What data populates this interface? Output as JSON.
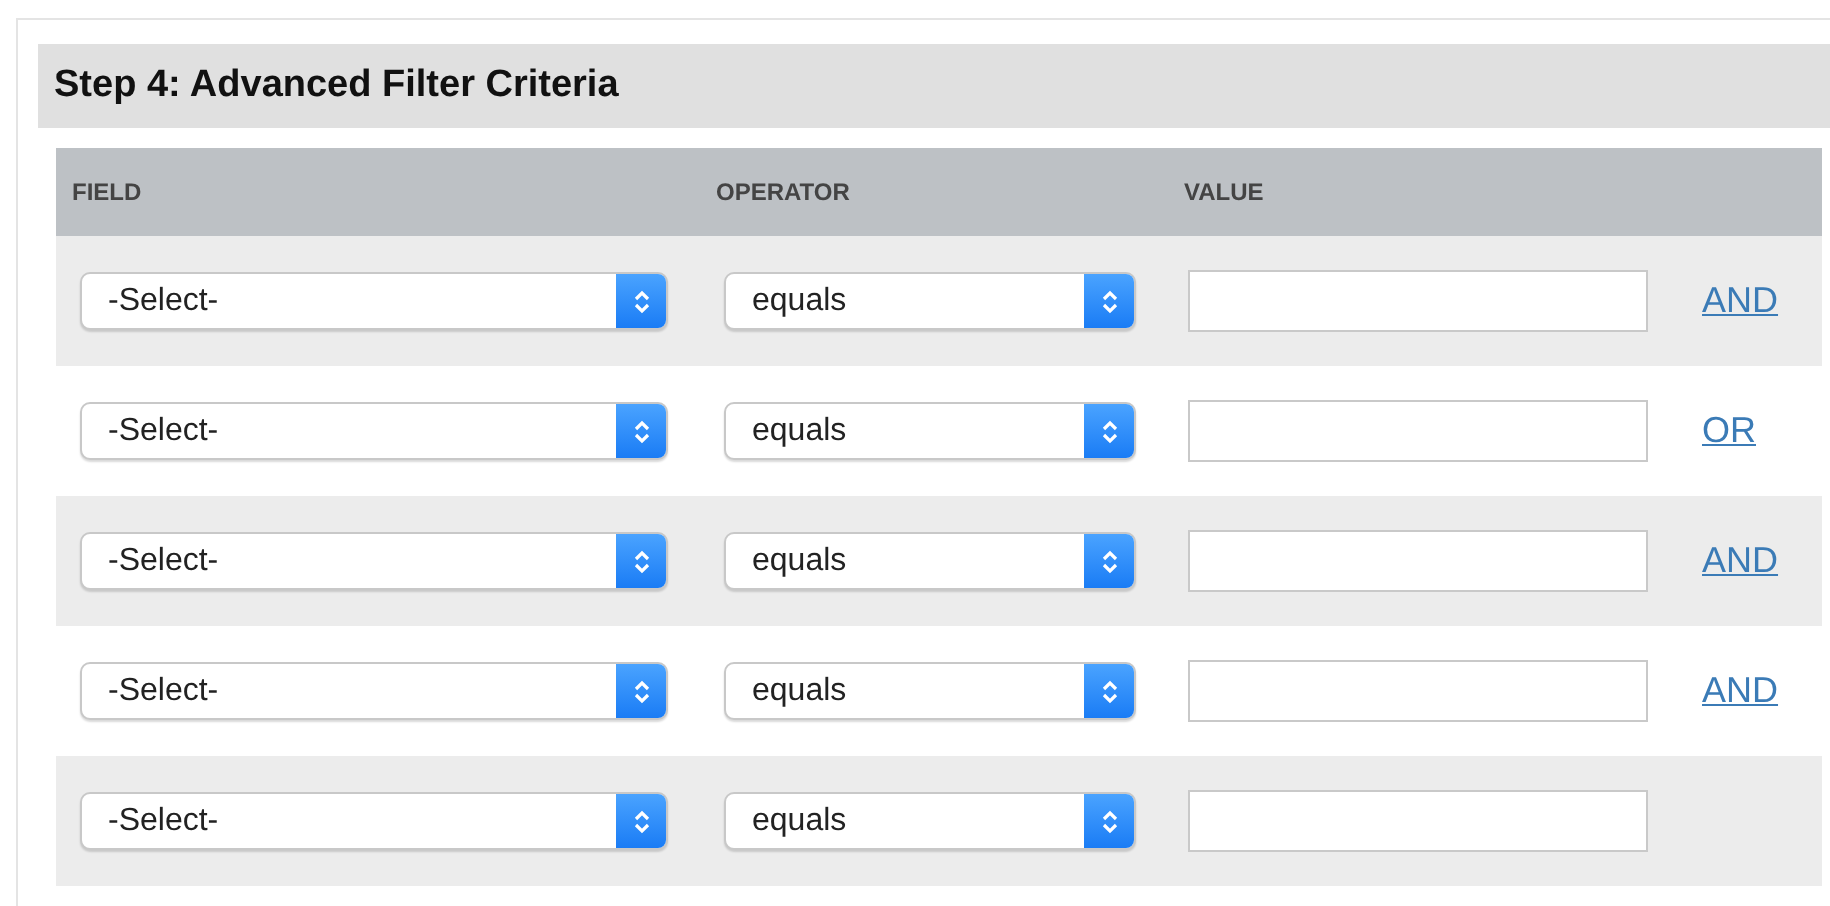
{
  "section": {
    "title": "Step 4: Advanced Filter Criteria"
  },
  "table": {
    "columns": [
      "FIELD",
      "OPERATOR",
      "VALUE"
    ],
    "rows": [
      {
        "field": "-Select-",
        "operator": "equals",
        "connector": "AND"
      },
      {
        "field": "-Select-",
        "operator": "equals",
        "connector": "OR"
      },
      {
        "field": "-Select-",
        "operator": "equals",
        "connector": "AND"
      },
      {
        "field": "-Select-",
        "operator": "equals",
        "connector": "AND"
      },
      {
        "field": "-Select-",
        "operator": "equals"
      }
    ]
  }
}
